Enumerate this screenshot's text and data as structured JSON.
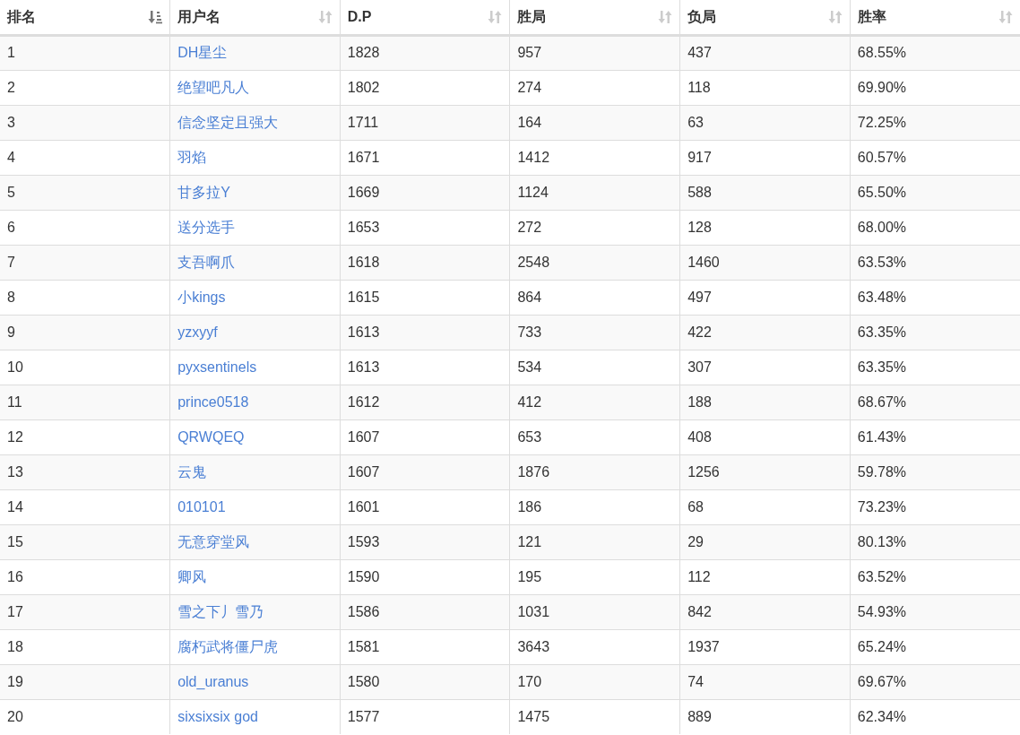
{
  "table": {
    "columns": [
      {
        "label": "排名",
        "sorted": true
      },
      {
        "label": "用户名",
        "sorted": false
      },
      {
        "label": "D.P",
        "sorted": false
      },
      {
        "label": "胜局",
        "sorted": false
      },
      {
        "label": "负局",
        "sorted": false
      },
      {
        "label": "胜率",
        "sorted": false
      }
    ],
    "rows": [
      [
        "1",
        "DH星尘",
        "1828",
        "957",
        "437",
        "68.55%"
      ],
      [
        "2",
        "绝望吧凡人",
        "1802",
        "274",
        "118",
        "69.90%"
      ],
      [
        "3",
        "信念坚定且强大",
        "1711",
        "164",
        "63",
        "72.25%"
      ],
      [
        "4",
        "羽焰",
        "1671",
        "1412",
        "917",
        "60.57%"
      ],
      [
        "5",
        "甘多拉Y",
        "1669",
        "1124",
        "588",
        "65.50%"
      ],
      [
        "6",
        "送分选手",
        "1653",
        "272",
        "128",
        "68.00%"
      ],
      [
        "7",
        "支吾啊爪",
        "1618",
        "2548",
        "1460",
        "63.53%"
      ],
      [
        "8",
        "小kings",
        "1615",
        "864",
        "497",
        "63.48%"
      ],
      [
        "9",
        "yzxyyf",
        "1613",
        "733",
        "422",
        "63.35%"
      ],
      [
        "10",
        "pyxsentinels",
        "1613",
        "534",
        "307",
        "63.35%"
      ],
      [
        "11",
        "prince0518",
        "1612",
        "412",
        "188",
        "68.67%"
      ],
      [
        "12",
        "QRWQEQ",
        "1607",
        "653",
        "408",
        "61.43%"
      ],
      [
        "13",
        "云鬼",
        "1607",
        "1876",
        "1256",
        "59.78%"
      ],
      [
        "14",
        "010101",
        "1601",
        "186",
        "68",
        "73.23%"
      ],
      [
        "15",
        "无意穿堂风",
        "1593",
        "121",
        "29",
        "80.13%"
      ],
      [
        "16",
        "卿风",
        "1590",
        "195",
        "112",
        "63.52%"
      ],
      [
        "17",
        "雪之下丿雪乃",
        "1586",
        "1031",
        "842",
        "54.93%"
      ],
      [
        "18",
        "腐朽武将僵尸虎",
        "1581",
        "3643",
        "1937",
        "65.24%"
      ],
      [
        "19",
        "old_uranus",
        "1580",
        "170",
        "74",
        "69.67%"
      ],
      [
        "20",
        "sixsixsix god",
        "1577",
        "1475",
        "889",
        "62.34%"
      ]
    ]
  }
}
